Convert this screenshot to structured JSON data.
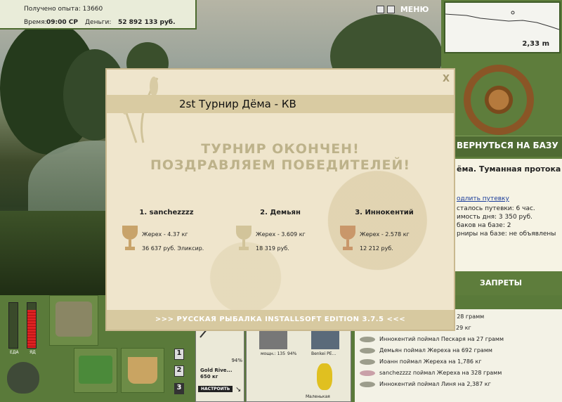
{
  "hud": {
    "exp_label": "Получено опыта:",
    "exp_value": "13660",
    "time_label": "Время:",
    "time_value": "09:00 СР",
    "money_label": "Деньги:",
    "money_value": "52 892 133 руб.",
    "menu_label": "МЕНЮ",
    "pause_icon": "pause-icon",
    "sound_icon": "sound-icon",
    "depth_value": "2,33 m"
  },
  "right_panel": {
    "return_button": "ВЕРНУТЬСЯ НА БАЗУ",
    "location_title": "ёма. Туманная протока",
    "extend_link": "одлить путевку",
    "line1": "сталось путевки: 6 час.",
    "line2": "имость дня: 3 350 руб.",
    "line3": "баков на базе: 2",
    "line4": "рниры на базе: не объявлены",
    "bans_label": "ЗАПРЕТЫ"
  },
  "bottom": {
    "gauge_labels": [
      "ЕДА",
      "ЯД"
    ],
    "page_buttons": [
      "1",
      "2",
      "3"
    ],
    "rod_name": "Gold Rive...",
    "rod_weight": "650 кг",
    "rod_percent": "94%",
    "setup_button": "НАСТРОИТЬ",
    "reel_label": "мощн.: 135",
    "reel_percent": "94%",
    "lure_label": "Benkei PE...",
    "bait_label": "Маленькая",
    "feed": [
      "ра на 28 грамм",
      "29 кг",
      "Иннокентий поймал Пескаря на 27 грамм",
      "Демьян поймал Жереха на 692 грамм",
      "Иоанн поймал Жереха на 1,786 кг",
      "sanchezzzz поймал Жереха на 328 грамм",
      "Иннокентий поймал Линя на 2,387 кг"
    ]
  },
  "dialog": {
    "title": "2st Турнир Дёма - КВ",
    "close_label": "X",
    "headline1": "ТУРНИР ОКОНЧЕН!",
    "headline2": "ПОЗДРАВЛЯЕМ ПОБЕДИТЕЛЕЙ!",
    "winners": [
      {
        "place": "1. sanchezzzz",
        "fish": "Жерех - 4.37 кг",
        "prize": "36 637 руб. Эликсир.",
        "cup_color": "#c8a36a"
      },
      {
        "place": "2. Демьян",
        "fish": "Жерех - 3.609 кг",
        "prize": "18 319 руб.",
        "cup_color": "#d2c49a"
      },
      {
        "place": "3. Иннокентий",
        "fish": "Жерех - 2.578 кг",
        "prize": "12 212 руб.",
        "cup_color": "#c9976a"
      }
    ],
    "footer": ">>> РУССКАЯ РЫБАЛКА INSTALLSOFT EDITION 3.7.5 <<<"
  }
}
